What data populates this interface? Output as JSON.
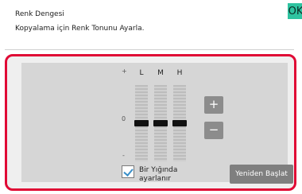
{
  "header": {
    "title": "Renk Dengesi",
    "subtitle": "Kopyalama için Renk Tonunu Ayarla.",
    "ok_label": "OK"
  },
  "panel": {
    "plus_symbol": "+",
    "zero_symbol": "0",
    "minus_symbol": "-",
    "sliders": [
      {
        "label": "L",
        "value": 0
      },
      {
        "label": "M",
        "value": 0
      },
      {
        "label": "H",
        "value": 0
      }
    ],
    "increase_label": "+",
    "decrease_label": "−",
    "checkbox": {
      "label": "Bir Yığında ayarlanır",
      "checked": true
    },
    "reset_label": "Yeniden Başlat"
  }
}
